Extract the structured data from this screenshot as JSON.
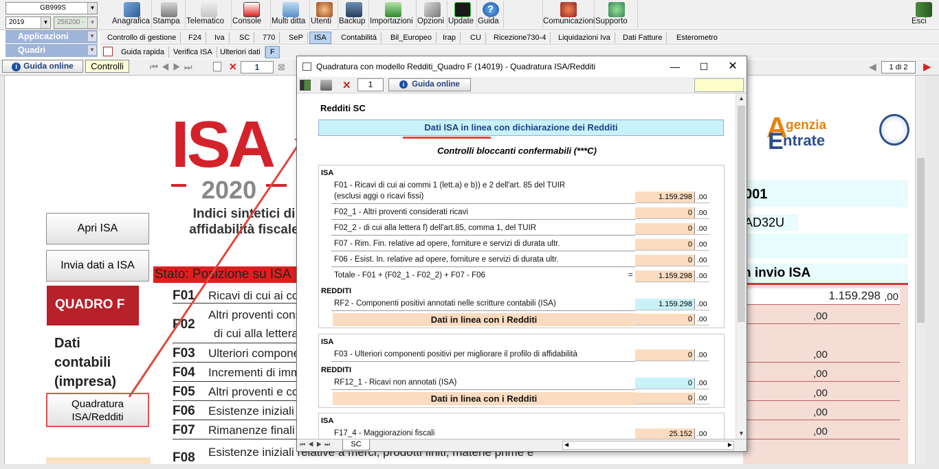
{
  "topbar": {
    "combo_company": "GB999S",
    "combo_year": "2019",
    "combo_code": "256200 -",
    "buttons": [
      "Anagrafica",
      "Stampa",
      "Telematico",
      "Console",
      "Multi ditta",
      "Utenti",
      "Backup",
      "Importazioni",
      "Opzioni",
      "Update",
      "Guida",
      "Comunicazioni",
      "Supporto",
      "Esci"
    ]
  },
  "menu": {
    "applicazioni": "Applicazioni",
    "quadri": "Quadri",
    "tabs": [
      "Controllo di gestione",
      "F24",
      "Iva",
      "SC",
      "770",
      "SeP",
      "ISA",
      "Contabilità",
      "Bil_Europeo",
      "Irap",
      "CU",
      "Ricezione730-4",
      "Liquidazioni Iva",
      "Dati Fatture",
      "Esterometro"
    ],
    "subtabs": [
      "Guida rapida",
      "Verifica ISA",
      "Ulteriori dati",
      "F"
    ]
  },
  "nav": {
    "guida_online": "Guida online",
    "controlli": "Controlli",
    "page_num": "1",
    "page_of": "1 di 2"
  },
  "doc": {
    "logo_isa": "ISA",
    "logo_year": "2020",
    "logo_sub1": "Indici sintetici di",
    "logo_sub2": "affidabilità fiscale",
    "btn_apri": "Apri ISA",
    "btn_invia": "Invia dati a ISA",
    "stato": "Stato: Posizione su ISA",
    "quadro_f": "QUADRO F",
    "dati1": "Dati",
    "dati2": "contabili",
    "dati3": "(impresa)",
    "btn_quadratura1": "Quadratura",
    "btn_quadratura2": "ISA/Redditi",
    "agenzia1": "genzia",
    "agenzia2": "ntrate",
    "code001": "001",
    "codead": "AD32U",
    "invio": "n invio ISA",
    "f01_val": "1.159.298",
    "dec": ",00",
    "rows": [
      {
        "code": "F01",
        "label": "Ricavi di cui ai com"
      },
      {
        "code": "F02",
        "label": "Altri proventi consi"
      },
      {
        "code": "",
        "label": "di cui alla lettera f"
      },
      {
        "code": "F03",
        "label": "Ulteriori componen"
      },
      {
        "code": "F04",
        "label": "Incrementi di immo"
      },
      {
        "code": "F05",
        "label": "Altri proventi e con"
      },
      {
        "code": "F06",
        "label": "Esistenze iniziali re"
      },
      {
        "code": "F07",
        "label": "Rimanenze finali re"
      },
      {
        "code": "F08",
        "label": "Esistenze iniziali relative a merci, prodotti finiti, materie prime e"
      }
    ]
  },
  "dialog": {
    "title": "Quadratura con modello Redditi_Quadro F (14019) - Quadratura ISA/Redditi",
    "page_num": "1",
    "guida_online": "Guida online",
    "redditi_sc": "Redditi SC",
    "banner": "Dati ISA in linea con dichiarazione dei Redditi",
    "controlli": "Controlli bloccanti confermabili (***C)",
    "sec_isa": "ISA",
    "sec_redditi": "REDDITI",
    "f01_line1": "F01 - Ricavi di cui ai commi 1 (lett.a) e b)) e 2 dell'art. 85 del TUIR",
    "f01_line2": "(esclusi aggi o ricavi fissi)",
    "f01_val": "1.159.298",
    "f02_1": "F02_1 - Altri proventi considerati ricavi",
    "f02_2": "F02_2 - di cui alla lettera f) dell'art.85, comma 1, del TUIR",
    "f07": "F07 - Rim. Fin. relative ad opere, forniture e servizi di durata ultr.",
    "f06": "F06 - Esist. In. relative ad opere, forniture e servizi di durata ultr.",
    "totale": "Totale - F01 + (F02_1 - F02_2) +  F07 - F06",
    "eq": "=",
    "totale_val": "1.159.298",
    "rf2": "RF2 - Componenti positivi annotati nelle scritture contabili (ISA)",
    "rf2_val": "1.159.298",
    "in_linea": "Dati in linea con i Redditi",
    "f03": "F03 - Ulteriori componenti positivi per migliorare il profilo di affidabilità",
    "rf12": "RF12_1 - Ricavi non annotati (ISA)",
    "f17": "F17_4 - Maggiorazioni fiscali",
    "f17_val": "25.152",
    "zero": "0",
    "dec": ".00",
    "sheet_tab": "SC"
  },
  "colors": {
    "accent_red": "#cc2b2b",
    "banner_cyan": "#c9f2f8",
    "field_orange": "#fbdcc0",
    "quadro_red": "#b8202a"
  }
}
